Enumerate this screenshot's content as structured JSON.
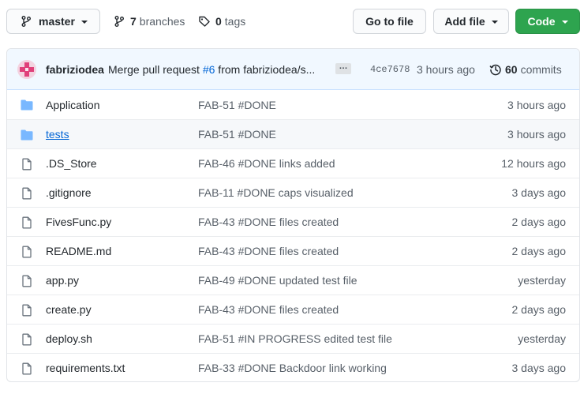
{
  "toolbar": {
    "branch": "master",
    "branches_count": "7",
    "branches_label": "branches",
    "tags_count": "0",
    "tags_label": "tags",
    "go_to_file": "Go to file",
    "add_file": "Add file",
    "code": "Code"
  },
  "commit": {
    "author": "fabriziodea",
    "message_prefix": "Merge pull request ",
    "pr": "#6",
    "message_suffix": " from fabriziodea/s...",
    "ellipsis": "…",
    "sha": "4ce7678",
    "time": "3 hours ago",
    "commits_count": "60",
    "commits_label": "commits"
  },
  "files": [
    {
      "type": "folder",
      "name": "Application",
      "message": "FAB-51 #DONE",
      "time": "3 hours ago"
    },
    {
      "type": "folder",
      "name": "tests",
      "message": "FAB-51 #DONE",
      "time": "3 hours ago"
    },
    {
      "type": "file",
      "name": ".DS_Store",
      "message": "FAB-46 #DONE links added",
      "time": "12 hours ago"
    },
    {
      "type": "file",
      "name": ".gitignore",
      "message": "FAB-11 #DONE caps visualized",
      "time": "3 days ago"
    },
    {
      "type": "file",
      "name": "FivesFunc.py",
      "message": "FAB-43 #DONE files created",
      "time": "2 days ago"
    },
    {
      "type": "file",
      "name": "README.md",
      "message": "FAB-43 #DONE files created",
      "time": "2 days ago"
    },
    {
      "type": "file",
      "name": "app.py",
      "message": "FAB-49 #DONE updated test file",
      "time": "yesterday"
    },
    {
      "type": "file",
      "name": "create.py",
      "message": "FAB-43 #DONE files created",
      "time": "2 days ago"
    },
    {
      "type": "file",
      "name": "deploy.sh",
      "message": "FAB-51 #IN PROGRESS edited test file",
      "time": "yesterday"
    },
    {
      "type": "file",
      "name": "requirements.txt",
      "message": "FAB-33 #DONE Backdoor link working",
      "time": "3 days ago"
    }
  ],
  "colors": {
    "folder": "#79b8ff",
    "link": "#0366d6",
    "code_button": "#2ea44f"
  }
}
